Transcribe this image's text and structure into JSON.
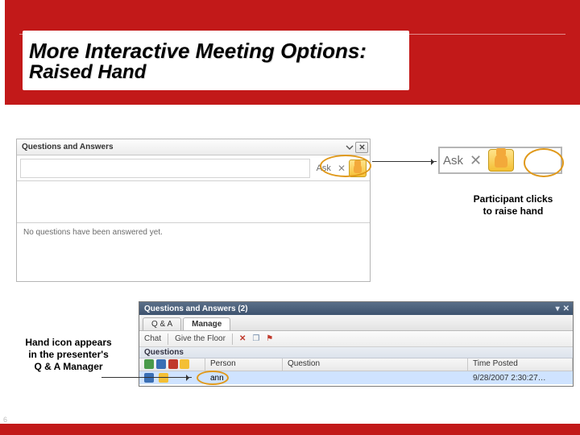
{
  "colors": {
    "accent": "#c21919",
    "annotation": "#e0991a"
  },
  "title": {
    "main": "More Interactive Meeting Options:",
    "sub": "Raised Hand"
  },
  "qa_panel": {
    "title": "Questions and Answers",
    "ask_label": "Ask",
    "status": "No questions have been answered yet."
  },
  "ask_zoom": {
    "label": "Ask"
  },
  "callouts": {
    "participant": "Participant clicks to raise hand",
    "presenter": "Hand icon appears in the presenter's Q & A Manager"
  },
  "mgr_panel": {
    "title": "Questions and Answers (2)",
    "tabs": [
      "Q & A",
      "Manage"
    ],
    "toolbar": {
      "chat": "Chat",
      "give_floor": "Give the Floor"
    },
    "subhead": "Questions",
    "columns": {
      "person": "Person",
      "question": "Question",
      "time": "Time Posted"
    },
    "row": {
      "person": "ann",
      "question": "",
      "time": "9/28/2007 2:30:27…"
    }
  },
  "page_number": "6"
}
